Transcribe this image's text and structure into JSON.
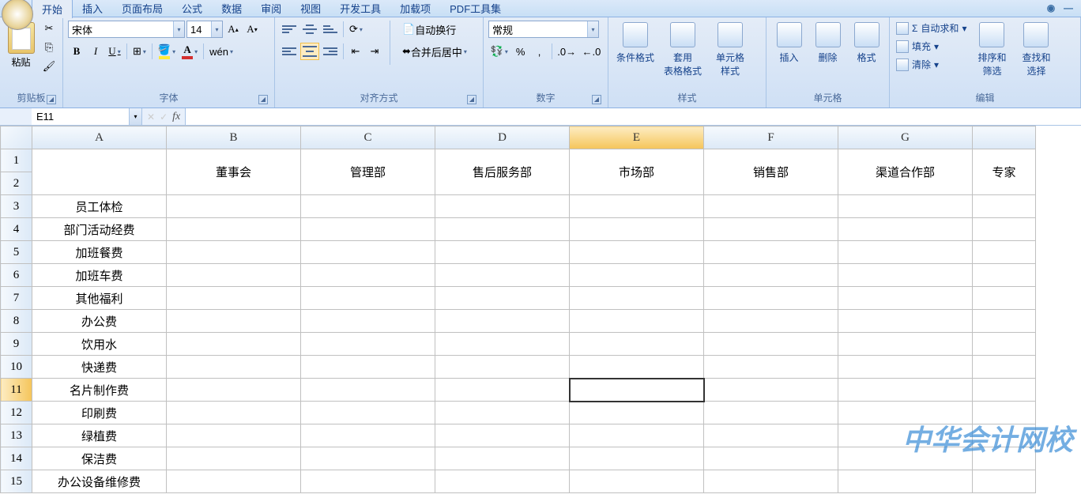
{
  "tabs": [
    "开始",
    "插入",
    "页面布局",
    "公式",
    "数据",
    "审阅",
    "视图",
    "开发工具",
    "加载项",
    "PDF工具集"
  ],
  "active_tab": 0,
  "ribbon": {
    "clipboard": {
      "paste": "粘贴",
      "label": "剪贴板"
    },
    "font": {
      "label": "字体",
      "name": "宋体",
      "size": "14"
    },
    "align": {
      "label": "对齐方式",
      "wrap": "自动换行",
      "merge": "合并后居中"
    },
    "number": {
      "label": "数字",
      "format": "常规"
    },
    "styles": {
      "label": "样式",
      "cond": "条件格式",
      "table": "套用\n表格格式",
      "cell": "单元格\n样式"
    },
    "cells": {
      "label": "单元格",
      "insert": "插入",
      "delete": "删除",
      "format": "格式"
    },
    "edit": {
      "label": "编辑",
      "autosum": "自动求和",
      "fill": "填充",
      "clear": "清除",
      "sort": "排序和\n筛选",
      "find": "查找和\n选择"
    }
  },
  "namebox": "E11",
  "columns": [
    "A",
    "B",
    "C",
    "D",
    "E",
    "F",
    "G"
  ],
  "col_headers": [
    "",
    "董事会",
    "管理部",
    "售后服务部",
    "市场部",
    "销售部",
    "渠道合作部",
    "专家"
  ],
  "rows": [
    {
      "n": 1,
      "merged": true
    },
    {
      "n": 3,
      "a": "员工体检"
    },
    {
      "n": 4,
      "a": "部门活动经费"
    },
    {
      "n": 5,
      "a": "加班餐费"
    },
    {
      "n": 6,
      "a": "加班车费"
    },
    {
      "n": 7,
      "a": "其他福利"
    },
    {
      "n": 8,
      "a": "办公费"
    },
    {
      "n": 9,
      "a": "饮用水"
    },
    {
      "n": 10,
      "a": "快递费"
    },
    {
      "n": 11,
      "a": "名片制作费",
      "sel": true
    },
    {
      "n": 12,
      "a": "印刷费"
    },
    {
      "n": 13,
      "a": "绿植费"
    },
    {
      "n": 14,
      "a": "保洁费"
    },
    {
      "n": 15,
      "a": "办公设备维修费"
    }
  ],
  "selected_cell": "E11",
  "selected_col_idx": 4,
  "watermark": "中华会计网校"
}
